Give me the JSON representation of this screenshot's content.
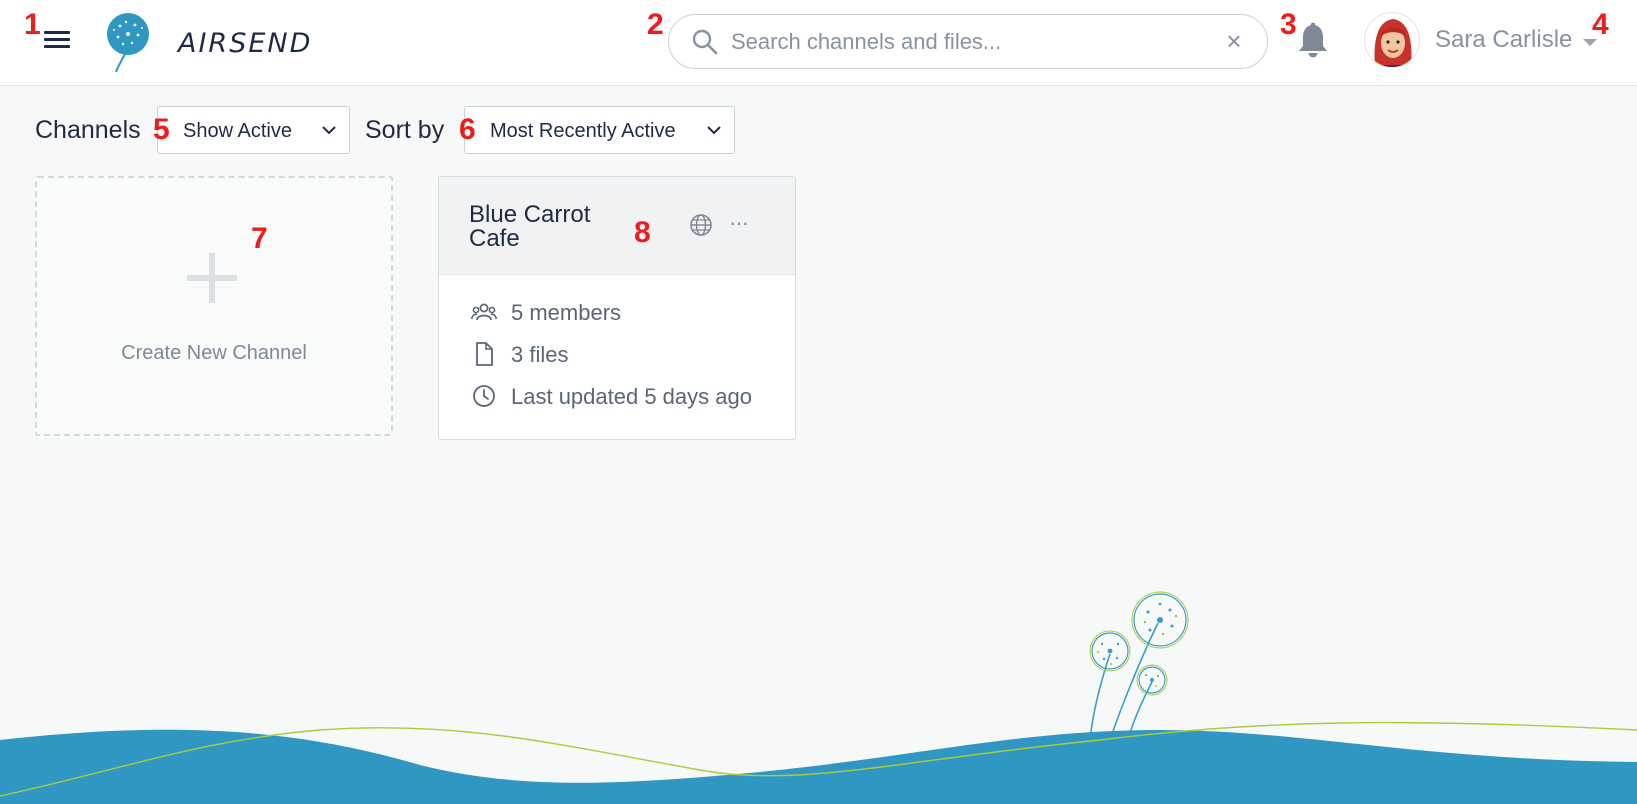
{
  "header": {
    "brand": "AIRSEND",
    "search": {
      "placeholder": "Search channels and files...",
      "value": ""
    },
    "clear_glyph": "×",
    "user": {
      "name": "Sara Carlisle"
    }
  },
  "filters": {
    "channels_label": "Channels",
    "channels_filter_value": "Show Active",
    "sort_label": "Sort by",
    "sort_value": "Most Recently Active"
  },
  "create_card": {
    "label": "Create New Channel"
  },
  "channel": {
    "name": "Blue Carrot Cafe",
    "members": "5 members",
    "files": "3 files",
    "updated": "Last updated 5 days ago",
    "more_glyph": "···"
  },
  "markers": [
    "1",
    "2",
    "3",
    "4",
    "5",
    "6",
    "7",
    "8"
  ],
  "colors": {
    "accent": "#2f97c1",
    "marker_red": "#ee1c1c",
    "text_dark": "#1f2a44",
    "text_muted": "#8792a2",
    "wave_blue": "#2f97c1",
    "wave_line": "#a9cc3e"
  },
  "icons": {
    "menu": "hamburger-icon",
    "logo": "dandelion-logo-icon",
    "search": "search-icon",
    "clear": "close-icon",
    "bell": "bell-icon",
    "user_caret": "caret-down-icon",
    "select_chevron": "chevron-down-icon",
    "create": "plus-icon",
    "globe": "globe-icon",
    "more": "more-dots-icon",
    "members": "users-icon",
    "files": "file-icon",
    "updated": "clock-icon"
  }
}
